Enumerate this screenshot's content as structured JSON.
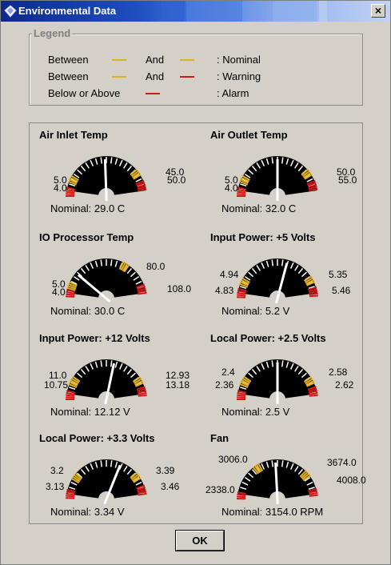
{
  "window": {
    "title": "Environmental Data",
    "close_glyph": "×",
    "icon": "diamond-icon"
  },
  "legend": {
    "title": "Legend",
    "rows": [
      {
        "prefix": "Between",
        "and": "And",
        "suffix": ": Nominal",
        "colors": [
          "#e0b020",
          "#e0b020"
        ]
      },
      {
        "prefix": "Between",
        "and": "And",
        "suffix": ": Warning",
        "colors": [
          "#e0b020",
          "#d01818"
        ]
      },
      {
        "prefix": "Below or Above",
        "and": "",
        "suffix": ": Alarm",
        "colors": [
          "#d01818"
        ]
      }
    ]
  },
  "colors": {
    "nominal": "#e0b020",
    "alarm": "#d01818",
    "needle": "#ffffff",
    "dial": "#000000"
  },
  "gauges": [
    {
      "title": "Air Inlet Temp",
      "nominal": "Nominal: 29.0 C",
      "low_alarm": "4.0",
      "low_warn": "5.0",
      "high_warn": "45.0",
      "high_alarm": "50.0"
    },
    {
      "title": "Air Outlet Temp",
      "nominal": "Nominal: 32.0 C",
      "low_alarm": "4.0",
      "low_warn": "5.0",
      "high_warn": "50.0",
      "high_alarm": "55.0"
    },
    {
      "title": "IO Processor Temp",
      "nominal": "Nominal: 30.0 C",
      "low_alarm": "4.0",
      "low_warn": "5.0",
      "high_warn": "80.0",
      "high_alarm": "108.0"
    },
    {
      "title": "Input Power: +5 Volts",
      "nominal": "Nominal: 5.2 V",
      "low_alarm": "4.83",
      "low_warn": "4.94",
      "high_warn": "5.35",
      "high_alarm": "5.46"
    },
    {
      "title": "Input Power: +12 Volts",
      "nominal": "Nominal: 12.12 V",
      "low_alarm": "10.75",
      "low_warn": "11.0",
      "high_warn": "12.93",
      "high_alarm": "13.18"
    },
    {
      "title": "Local Power: +2.5 Volts",
      "nominal": "Nominal: 2.5 V",
      "low_alarm": "2.36",
      "low_warn": "2.4",
      "high_warn": "2.58",
      "high_alarm": "2.62"
    },
    {
      "title": "Local Power: +3.3 Volts",
      "nominal": "Nominal: 3.34 V",
      "low_alarm": "3.13",
      "low_warn": "3.2",
      "high_warn": "3.39",
      "high_alarm": "3.46"
    },
    {
      "title": "Fan",
      "nominal": "Nominal: 3154.0 RPM",
      "low_alarm": "2338.0",
      "low_warn": "3006.0",
      "high_warn": "3674.0",
      "high_alarm": "4008.0"
    }
  ],
  "buttons": {
    "ok": "OK"
  }
}
